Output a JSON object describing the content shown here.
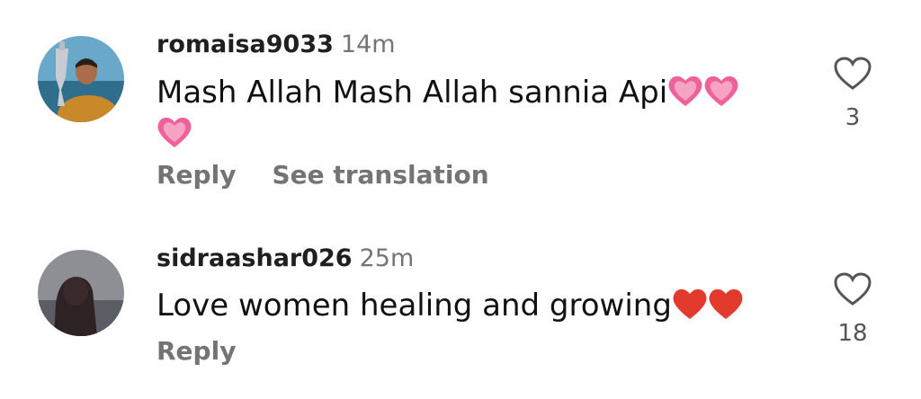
{
  "comments": [
    {
      "username": "romaisa9033",
      "time": "14m",
      "text": "Mash Allah Mash Allah sannia Api",
      "emoji": "heart-emoji",
      "reply_label": "Reply",
      "translate_label": "See translation",
      "like_count": "3",
      "like_icon": "heart-outline-icon"
    },
    {
      "username": "sidraashar026",
      "time": "25m",
      "text": "Love women healing and growing",
      "emoji": "red-heart-emoji",
      "reply_label": "Reply",
      "like_count": "18",
      "like_icon": "heart-outline-icon"
    }
  ],
  "colors": {
    "username": "#1f1f1f",
    "secondary": "#757575",
    "pink_heart": "#f0609a",
    "red_heart": "#e23b2e"
  }
}
